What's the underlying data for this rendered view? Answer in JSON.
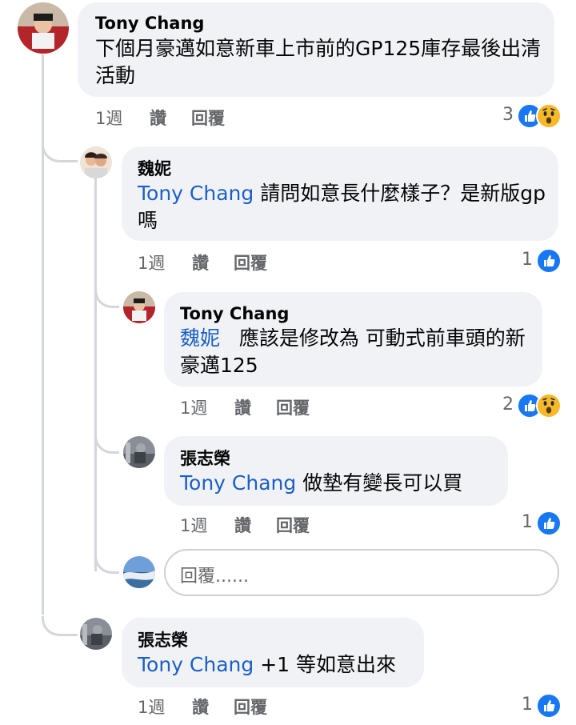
{
  "comments": [
    {
      "author": "Tony Chang",
      "mention": "",
      "text": "下個月豪邁如意新車上市前的GP125庫存最後出清活動",
      "time": "1週",
      "like": "讚",
      "reply": "回覆",
      "reaction_count": "3",
      "reactions": [
        "like",
        "wow"
      ]
    },
    {
      "author": "魏妮",
      "mention": "Tony Chang",
      "text": " 請問如意長什麼樣子？是新版gp嗎",
      "time": "1週",
      "like": "讚",
      "reply": "回覆",
      "reaction_count": "1",
      "reactions": [
        "like"
      ]
    },
    {
      "author": "Tony Chang",
      "mention": "魏妮",
      "text": "   應該是修改為 可動式前車頭的新豪邁125",
      "time": "1週",
      "like": "讚",
      "reply": "回覆",
      "reaction_count": "2",
      "reactions": [
        "like",
        "wow"
      ]
    },
    {
      "author": "張志榮",
      "mention": "Tony Chang",
      "text": " 做墊有變長可以買",
      "time": "1週",
      "like": "讚",
      "reply": "回覆",
      "reaction_count": "1",
      "reactions": [
        "like"
      ]
    },
    {
      "author": "張志榮",
      "mention": "Tony Chang",
      "text": " +1 等如意出來",
      "time": "1週",
      "like": "讚",
      "reply": "回覆",
      "reaction_count": "1",
      "reactions": [
        "like"
      ]
    }
  ],
  "reply_input": {
    "placeholder": "回覆......"
  },
  "colors": {
    "mention": "#1b5fc7",
    "bubble": "#f0f2f5",
    "like": "#1877f2",
    "wow": "#f7b928"
  }
}
